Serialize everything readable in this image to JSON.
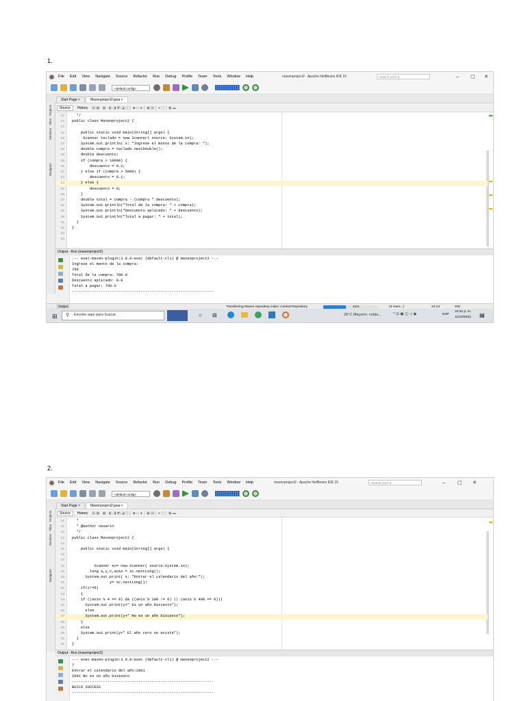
{
  "sections": [
    {
      "number": "1.",
      "window_title": "mavenproject2 - Apache NetBeans IDE 15",
      "search_placeholder": "Search (Ctrl+I)",
      "config": "<default config>",
      "menu": [
        "File",
        "Edit",
        "View",
        "Navigate",
        "Source",
        "Refactor",
        "Run",
        "Debug",
        "Profile",
        "Team",
        "Tools",
        "Window",
        "Help"
      ],
      "tabs": [
        "Start Page ×",
        "Mavenproject2.java ×"
      ],
      "side_panels": [
        "Projects",
        "Files",
        "Services",
        "Navigator"
      ],
      "editor_tabs": [
        "Source",
        "History"
      ],
      "code_lines": [
        {
          "n": "12",
          "t": "  */"
        },
        {
          "n": "13",
          "t": "public class Mavenproject2 {"
        },
        {
          "n": "14",
          "t": ""
        },
        {
          "n": "15",
          "t": "    public static void main(String[] args) {"
        },
        {
          "n": "16",
          "t": "     Scanner teclado = new Scanner( source: System.in);"
        },
        {
          "n": "17",
          "t": "    System.out.println( x: \"Ingrese el monto de la compra: \");"
        },
        {
          "n": "18",
          "t": "    double compra = teclado.nextDouble();"
        },
        {
          "n": "19",
          "t": "    double descuento;"
        },
        {
          "n": "20",
          "t": "    if (compra > 10000) {"
        },
        {
          "n": "21",
          "t": "        descuento = 0.2;"
        },
        {
          "n": "22",
          "t": "    } else if (compra > 5000) {"
        },
        {
          "n": "23",
          "t": "        descuento = 0.1;"
        },
        {
          "n": "24",
          "t": "    } else {"
        },
        {
          "n": "25",
          "t": "        descuento = 0;"
        },
        {
          "n": "26",
          "t": "    }"
        },
        {
          "n": "27",
          "t": "    double total = compra - (compra * descuento);"
        },
        {
          "n": "28",
          "t": "    System.out.println(\"Total de la compra: \" + compra);"
        },
        {
          "n": "29",
          "t": "    System.out.println(\"Descuento aplicado: \" + descuento);"
        },
        {
          "n": "30",
          "t": "    System.out.println(\"Total a pagar: \" + total);"
        },
        {
          "n": "31",
          "t": "  }"
        },
        {
          "n": "32",
          "t": "}"
        },
        {
          "n": "33",
          "t": ""
        },
        {
          "n": "34",
          "t": ""
        }
      ],
      "highlight_line": "24",
      "output_title": "Output - Run (mavenproject2)",
      "output_lines": [
        "--- exec-maven-plugin:3.0.0:exec (default-cli) @ mavenproject2 ---",
        "Ingrese el monto de la compra:",
        "700",
        "Total de la compra: 700.0",
        "Descuento aplicado: 0.0",
        "Total a pagar: 700.0",
        "----------------------------------------------------------------"
      ],
      "status_tab": "Output",
      "status_text": "Transferring Maven repository index: Central Repository",
      "status_percent": "41%",
      "status_more": "(3 more...)",
      "status_pos": "24:13",
      "status_ins": "INS",
      "taskbar_search": "Escribe aquí para buscar",
      "weather": "26°C  Mayorm. nubla...",
      "lang": "ESP",
      "time": "10:31 p. m.",
      "date": "11/10/2022"
    },
    {
      "number": "2.",
      "window_title": "mavenproject2 - Apache NetBeans IDE 15",
      "search_placeholder": "Search (Ctrl+I)",
      "config": "<default config>",
      "menu": [
        "File",
        "Edit",
        "View",
        "Navigate",
        "Source",
        "Refactor",
        "Run",
        "Debug",
        "Profile",
        "Team",
        "Tools",
        "Window",
        "Help"
      ],
      "tabs": [
        "Start Page ×",
        "Mavenproject2.java ×"
      ],
      "side_panels": [
        "Projects",
        "Files",
        "Services",
        "Navigator"
      ],
      "editor_tabs": [
        "Source",
        "History"
      ],
      "code_lines": [
        {
          "n": "10",
          "t": "  *"
        },
        {
          "n": "11",
          "t": "  * @author usuario"
        },
        {
          "n": "12",
          "t": "  */"
        },
        {
          "n": "13",
          "t": "public class Mavenproject2 {"
        },
        {
          "n": "14",
          "t": ""
        },
        {
          "n": "15",
          "t": "    public static void main(String[] args) {"
        },
        {
          "n": "16",
          "t": ""
        },
        {
          "n": "17",
          "t": ""
        },
        {
          "n": "18",
          "t": "          Scanner sc= new Scanner( source:System.in);"
        },
        {
          "n": "19",
          "t": "        long a,y,c,anio = sc.nextLong();"
        },
        {
          "n": "20",
          "t": "      System.out.print( s: \"Entrar el calendario del año:\");"
        },
        {
          "n": "21",
          "t": "                 y= sc.nextLong();"
        },
        {
          "n": "22",
          "t": "    if(y!=0)"
        },
        {
          "n": "23",
          "t": "    {"
        },
        {
          "n": "24",
          "t": "    if ((anio % 4 == 0) && ((anio % 100 != 0) || (anio % 400 == 0)))"
        },
        {
          "n": "25",
          "t": "      System.out.print(y+\" Es un año bisiesto\");"
        },
        {
          "n": "26",
          "t": "      else"
        },
        {
          "n": "27",
          "t": "      System.out.print(y+\" No es un año bisiesto\");"
        },
        {
          "n": "28",
          "t": "    }"
        },
        {
          "n": "29",
          "t": "    else"
        },
        {
          "n": "30",
          "t": "    System.out.print(y+\" El año cero no existe\");"
        },
        {
          "n": "31",
          "t": "  }"
        },
        {
          "n": "32",
          "t": "}"
        }
      ],
      "highlight_line": "27",
      "output_title": "Output - Run (mavenproject2)",
      "output_lines": [
        "--- exec-maven-plugin:3.0.0:exec (default-cli) @ mavenproject2 ---",
        "7",
        "Entrar el calendario del año:2001",
        "2001 No es un año bisiesto",
        "----------------------------------------------------------------",
        "BUILD SUCCESS",
        "----------------------------------------------------------------"
      ]
    }
  ]
}
